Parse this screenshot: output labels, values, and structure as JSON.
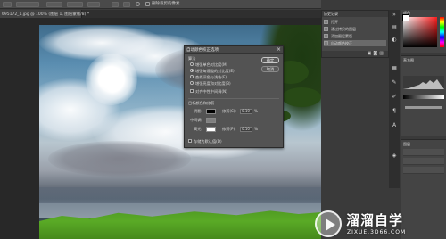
{
  "options_bar": {
    "checkbox_label": "删除裁剪的像素"
  },
  "document_tab": {
    "title": "095172_1.jpg @ 100% (图层 1, 图层蒙版/8) *"
  },
  "dialog": {
    "title": "自动颜色校正选项",
    "algorithms_heading": "算法",
    "options": [
      "增强单色对比度(M)",
      "增强每通道的对比度(E)",
      "查找深色与浅色(F)",
      "增强亮度和对比度(B)"
    ],
    "selected_option_index": 1,
    "snap_label": "对齐中性中间调(N)",
    "target_heading": "目标颜色和修剪",
    "shadows_label": "阴影:",
    "midtones_label": "中间调:",
    "highlights_label": "高光:",
    "clip1_label": "修剪(C):",
    "clip1_value": "0.10",
    "clip1_unit": "%",
    "clip2_label": "修剪(P):",
    "clip2_value": "0.10",
    "clip2_unit": "%",
    "save_default_label": "存储为默认值(D)",
    "ok_label": "确定",
    "cancel_label": "取消",
    "shadow_color": "#000000",
    "highlight_color": "#ffffff"
  },
  "history_panel": {
    "tab_label": "历史记录",
    "items": [
      "打开",
      "通过拷贝的图层",
      "添加图层蒙版",
      "自动颜色校正"
    ],
    "selected_index": 3
  },
  "color_panel": {
    "tab_label": "颜色",
    "hue_color": "#ff1e1e"
  },
  "histogram_panel": {
    "tab_label": "直方图"
  },
  "layers_panel": {
    "tab_label": "图层"
  },
  "watermark": {
    "title": "溜溜自学",
    "url": "ZIXUE.3D66.COM"
  }
}
